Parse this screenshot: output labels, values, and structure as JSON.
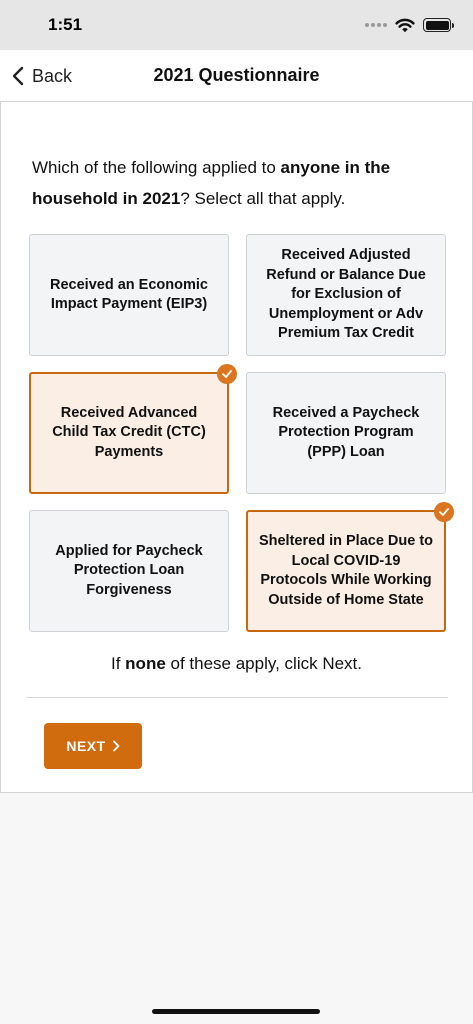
{
  "status_bar": {
    "time": "1:51"
  },
  "nav": {
    "back_label": "Back",
    "title": "2021 Questionnaire"
  },
  "question": {
    "part1": "Which of the following applied to ",
    "emphasis": "anyone in the household in 2021",
    "part2": "? Select all that apply."
  },
  "options": [
    {
      "label": "Received an Economic Impact Payment (EIP3)",
      "selected": false
    },
    {
      "label": "Received Adjusted Refund or Balance Due for Exclusion of Unemployment or Adv Premium Tax Credit",
      "selected": false
    },
    {
      "label": "Received Advanced Child Tax Credit (CTC) Payments",
      "selected": true
    },
    {
      "label": "Received a Paycheck Protection Program (PPP) Loan",
      "selected": false
    },
    {
      "label": "Applied for Paycheck Protection Loan Forgiveness",
      "selected": false
    },
    {
      "label": "Sheltered in Place Due to Local COVID-19 Protocols While Working Outside of Home State",
      "selected": true
    }
  ],
  "hint": {
    "part1": "If ",
    "emphasis": "none",
    "part2": " of these apply, click Next."
  },
  "next_button": {
    "label": "NEXT"
  },
  "colors": {
    "accent": "#d06c0e",
    "selected_bg": "#fbeee4",
    "selected_border": "#c9690f",
    "unselected_bg": "#f3f4f6"
  }
}
